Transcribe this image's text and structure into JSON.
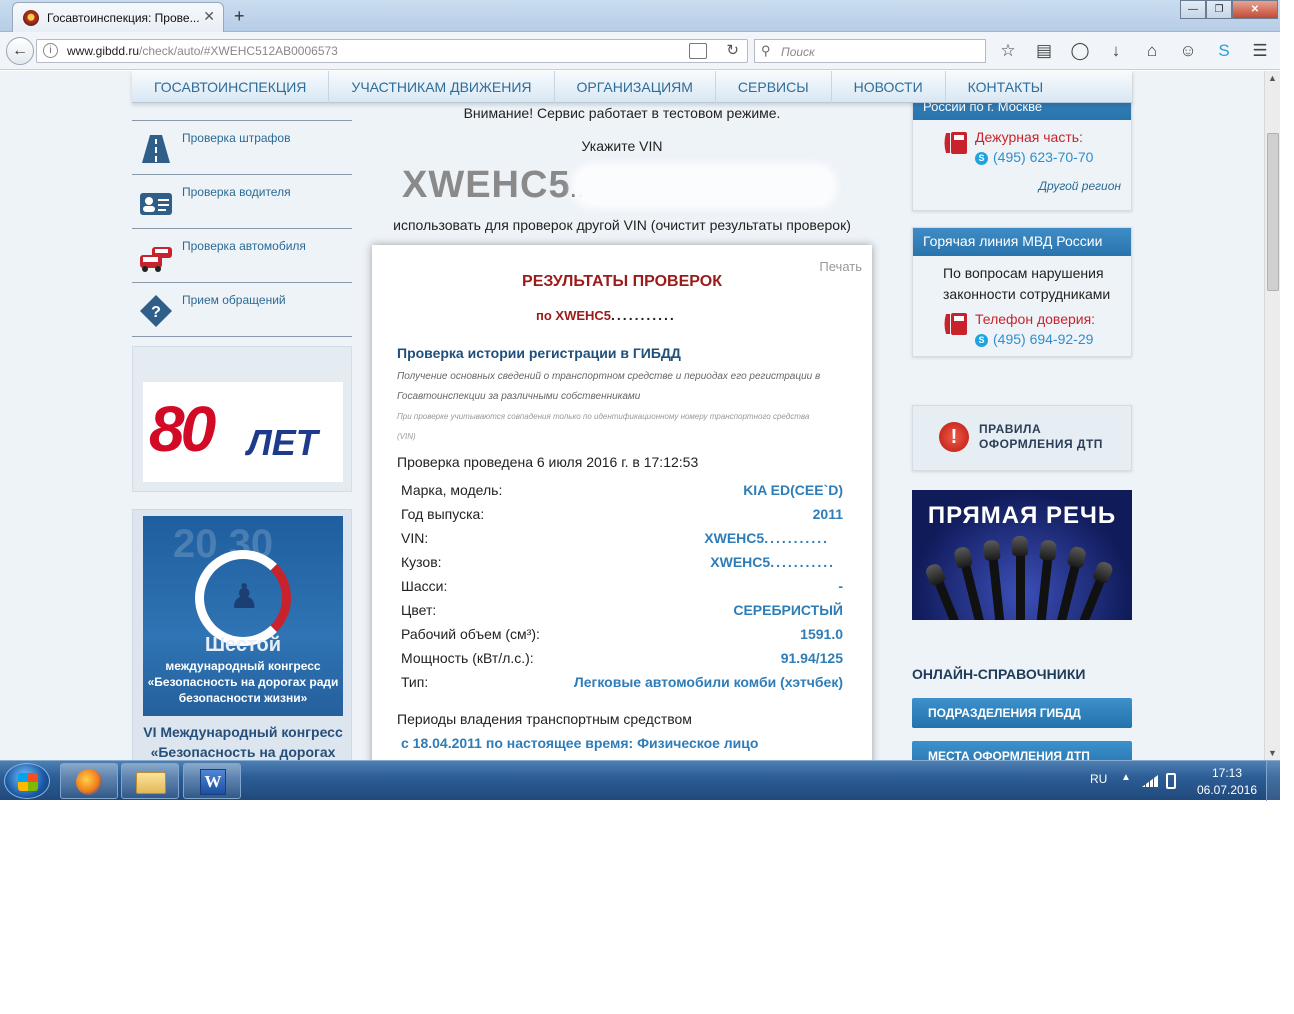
{
  "browser": {
    "tab_title": "Госавтоинспекция: Прове...",
    "tab_close": "✕",
    "new_tab": "+",
    "url_domain": "www.gibdd.ru",
    "url_path": "/check/auto/#XWEHC512AB0006573",
    "search_placeholder": "Поиск",
    "window_buttons": [
      "—",
      "❐",
      "✕"
    ]
  },
  "site_nav": {
    "items": [
      "ГОСАВТОИНСПЕКЦИЯ",
      "УЧАСТНИКАМ ДВИЖЕНИЯ",
      "ОРГАНИЗАЦИЯМ",
      "СЕРВИСЫ",
      "НОВОСТИ",
      "КОНТАКТЫ"
    ]
  },
  "left_column": {
    "services": [
      {
        "label": "Проверка штрафов",
        "icon": "road-icon"
      },
      {
        "label": "Проверка водителя",
        "icon": "driver-card-icon"
      },
      {
        "label": "Проверка автомобиля",
        "icon": "cars-icon"
      },
      {
        "label": "Прием обращений",
        "icon": "question-icon"
      }
    ],
    "promo_80": {
      "number": "80",
      "suffix": "ЛЕТ"
    },
    "congress": {
      "image_year": "20 30",
      "image_title": "Шестой",
      "image_text": "международный конгресс «Безопасность на дорогах ради безопасности жизни»",
      "caption": "VI Международный конгресс «Безопасность на дорогах ради безопасности жизни»"
    }
  },
  "center": {
    "notice": "Внимание! Сервис работает в тестовом режиме.",
    "vin_label": "Укажите VIN",
    "vin_value": "XWEHC5",
    "vin_masked": "...........",
    "alt_vin_link": "использовать для проверок другой VIN (очистит результаты проверок)",
    "results": {
      "print": "Печать",
      "title": "РЕЗУЛЬТАТЫ ПРОВЕРОК",
      "subtitle_prefix": "по XWEHC5",
      "subtitle_masked": "...........",
      "section_title": "Проверка истории регистрации в ГИБДД",
      "section_desc": "Получение основных сведений о транспортном средстве и периодах его регистрации в Госавтоинспекции за различными собственниками",
      "section_note": "При проверке учитываются совпадения только по идентификационному номеру транспортного средства (VIN)",
      "checked_at": "Проверка проведена 6 июля 2016 г. в 17:12:53",
      "fields": [
        {
          "key": "Марка, модель:",
          "value": "KIA ED(CEE`D)"
        },
        {
          "key": "Год выпуска:",
          "value": "2011"
        },
        {
          "key": "VIN:",
          "value": "XWEHC5",
          "masked": "..........."
        },
        {
          "key": "Кузов:",
          "value": "XWEHC5",
          "masked": "..........."
        },
        {
          "key": "Шасси:",
          "value": "-"
        },
        {
          "key": "Цвет:",
          "value": "СЕРЕБРИСТЫЙ"
        },
        {
          "key": "Рабочий объем (см³):",
          "value": "1591.0"
        },
        {
          "key": "Мощность (кВт/л.с.):",
          "value": "91.94/125"
        },
        {
          "key": "Тип:",
          "value": "Легковые автомобили комби (хэтчбек)"
        }
      ],
      "ownership_head": "Периоды владения транспортным средством",
      "ownership_row": "с 18.04.2011 по настоящее время: Физическое лицо"
    }
  },
  "right_column": {
    "moscow_box": {
      "head": "России по г. Москве",
      "duty_label": "Дежурная часть:",
      "duty_phone": "(495) 623-70-70",
      "other_region": "Другой регион"
    },
    "hotline_box": {
      "head": "Горячая линия МВД России",
      "text": "По вопросам нарушения законности сотрудниками",
      "trust_label": "Телефон доверия:",
      "trust_phone": "(495) 694-92-29"
    },
    "rules": {
      "line1": "ПРАВИЛА",
      "line2": "ОФОРМЛЕНИЯ ДТП"
    },
    "speech": {
      "title": "ПРЯМАЯ РЕЧЬ"
    },
    "directories": {
      "head": "ОНЛАЙН-СПРАВОЧНИКИ",
      "buttons": [
        "ПОДРАЗДЕЛЕНИЯ ГИБДД",
        "МЕСТА ОФОРМЛЕНИЯ ДТП"
      ]
    }
  },
  "taskbar": {
    "lang": "RU",
    "time": "17:13",
    "date": "06.07.2016",
    "word_letter": "W"
  }
}
